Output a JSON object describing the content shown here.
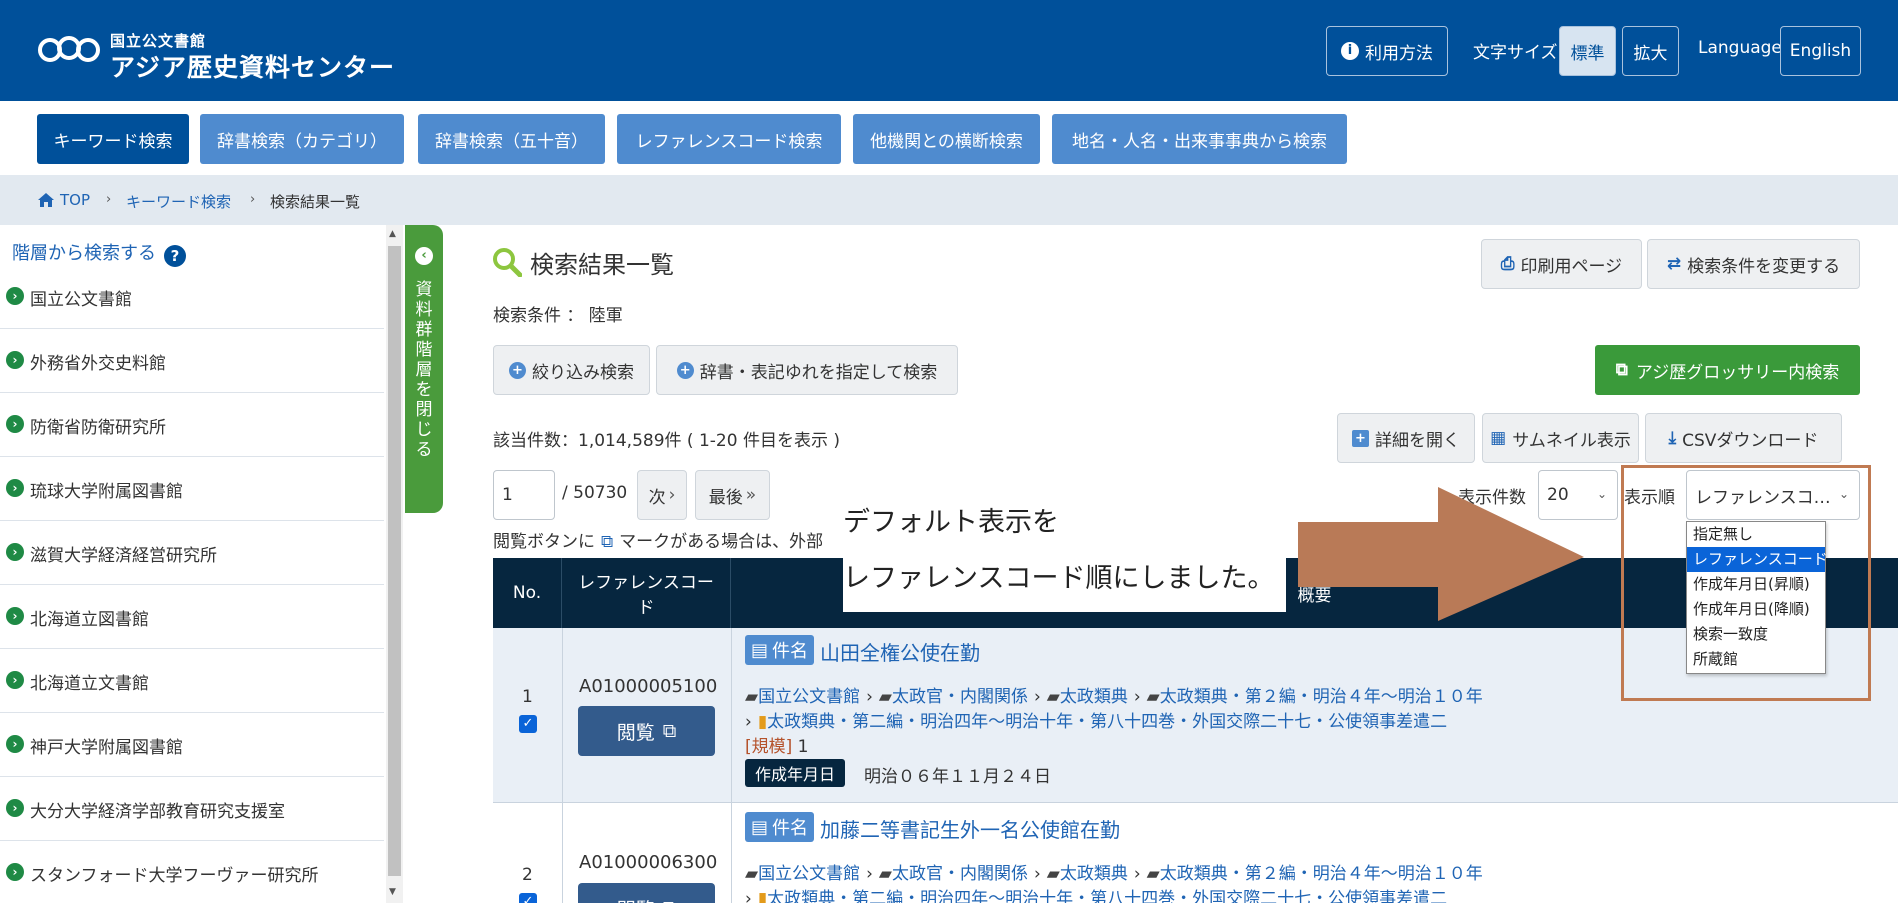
{
  "colors": {
    "header_bg": "#00509a",
    "tab": "#4f8bcf",
    "tab_active": "#00509a",
    "table_header": "#06263f",
    "green": "#3a9a3a",
    "link": "#1f64b4",
    "annotation": "#c07a52"
  },
  "header": {
    "logo_line1": "国立公文書館",
    "logo_line2": "アジア歴史資料センター",
    "usage_label": "利用方法",
    "font_size_label": "文字サイズ",
    "font_standard": "標準",
    "font_large": "拡大",
    "language_label": "Language",
    "language_button": "English"
  },
  "tabs": [
    "キーワード検索",
    "辞書検索（カテゴリ）",
    "辞書検索（五十音）",
    "レファレンスコード検索",
    "他機関との横断検索",
    "地名・人名・出来事事典から検索"
  ],
  "breadcrumb": {
    "top": "TOP",
    "keyword": "キーワード検索",
    "current": "検索結果一覧"
  },
  "sidebar": {
    "title": "階層から検索する",
    "collapse_label": "資料群階層を閉じる",
    "items": [
      "国立公文書館",
      "外務省外交史料館",
      "防衛省防衛研究所",
      "琉球大学附属図書館",
      "滋賀大学経済経営研究所",
      "北海道立図書館",
      "北海道立文書館",
      "神戸大学附属図書館",
      "大分大学経済学部教育研究支援室",
      "スタンフォード大学フーヴァー研究所"
    ]
  },
  "main": {
    "title": "検索結果一覧",
    "print_button": "印刷用ページ",
    "change_button": "検索条件を変更する",
    "condition_label": "検索条件 ： 陸軍",
    "refine_button": "絞り込み検索",
    "dict_button": "辞書・表記ゆれを指定して検索",
    "glossary_button": "アジ歴グロッサリー内検索",
    "count_text": "該当件数：1,014,589件 ( 1-20 件目を表示 )",
    "detail_button": "詳細を開く",
    "thumb_button": "サムネイル表示",
    "csv_button": "CSVダウンロード",
    "page_input": "1",
    "total_pages": "/ 50730",
    "next_button": "次",
    "last_button": "最後",
    "per_page_label": "表示件数",
    "per_page_value": "20",
    "sort_label": "表示順",
    "sort_value": "レファレンスコ…",
    "sort_options": [
      "指定無し",
      "レファレンスコード",
      "作成年月日(昇順)",
      "作成年月日(降順)",
      "検索一致度",
      "所蔵館"
    ],
    "view_note": "閲覧ボタンに",
    "view_note_tail": "マークがある場合は、外部"
  },
  "table": {
    "headers": [
      "No.",
      "レファレンスコード",
      "概要"
    ],
    "badge_label": "件名",
    "view_label": "閲覧",
    "scale_label": "[規模]",
    "date_label": "作成年月日",
    "rows": [
      {
        "no": "1",
        "ref": "A01000005100",
        "title": "山田全権公使在勤",
        "path": [
          "国立公文書館",
          "太政官・内閣関係",
          "太政類典",
          "太政類典・第２編・明治４年～明治１０年"
        ],
        "path2": "太政類典・第二編・明治四年～明治十年・第八十四巻・外国交際二十七・公使領事差遣二",
        "scale": "1",
        "date": "明治０６年１１月２４日"
      },
      {
        "no": "2",
        "ref": "A01000006300",
        "title": "加藤二等書記生外一名公使館在勤",
        "path": [
          "国立公文書館",
          "太政官・内閣関係",
          "太政類典",
          "太政類典・第２編・明治４年～明治１０年"
        ],
        "path2": "太政類典・第二編・明治四年～明治十年・第八十四巻・外国交際二十七・公使領事差遣二"
      }
    ]
  },
  "annotation": {
    "line1": "デフォルト表示を",
    "line2": "レファレンスコード順にしました。"
  }
}
